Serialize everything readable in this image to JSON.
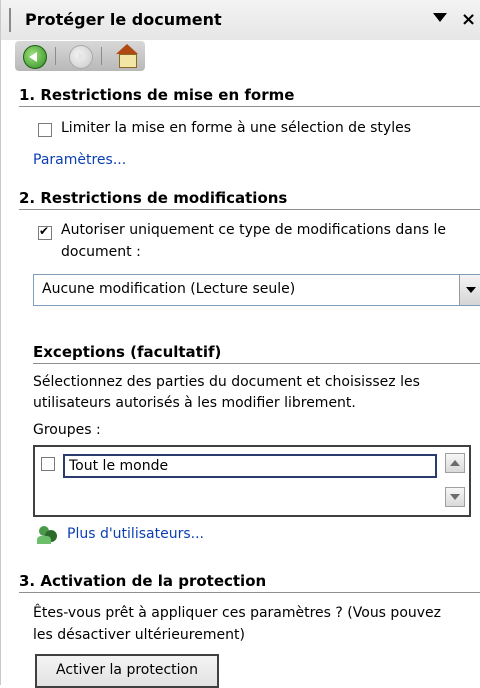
{
  "pane": {
    "title": "Protéger le document"
  },
  "nav": {
    "icons": [
      "back-icon",
      "forward-icon",
      "home-icon"
    ]
  },
  "section1": {
    "heading": "1. Restrictions de mise en forme",
    "checkbox_label": "Limiter la mise en forme à une sélection de styles",
    "checked": false,
    "link": "Paramètres..."
  },
  "section2": {
    "heading": "2. Restrictions de modifications",
    "checkbox_label_line1": "Autoriser uniquement ce type de modifications dans le",
    "checkbox_label_line2": "document :",
    "checked": true,
    "select_value": "Aucune modification (Lecture seule)"
  },
  "exceptions": {
    "heading": "Exceptions (facultatif)",
    "description_line1": "Sélectionnez des parties du document et choisissez les",
    "description_line2": "utilisateurs autorisés à les modifier librement.",
    "groups_label": "Groupes :",
    "groups": [
      {
        "label": "Tout le monde",
        "checked": false
      }
    ],
    "more_users_link": "Plus d'utilisateurs..."
  },
  "section3": {
    "heading": "3. Activation de la protection",
    "text_line1": "Êtes-vous prêt à appliquer ces paramètres ? (Vous pouvez",
    "text_line2": "les désactiver ultérieurement)",
    "button": "Activer la protection"
  },
  "colors": {
    "link": "#0b3fb3",
    "rule": "#8f8f8f"
  }
}
